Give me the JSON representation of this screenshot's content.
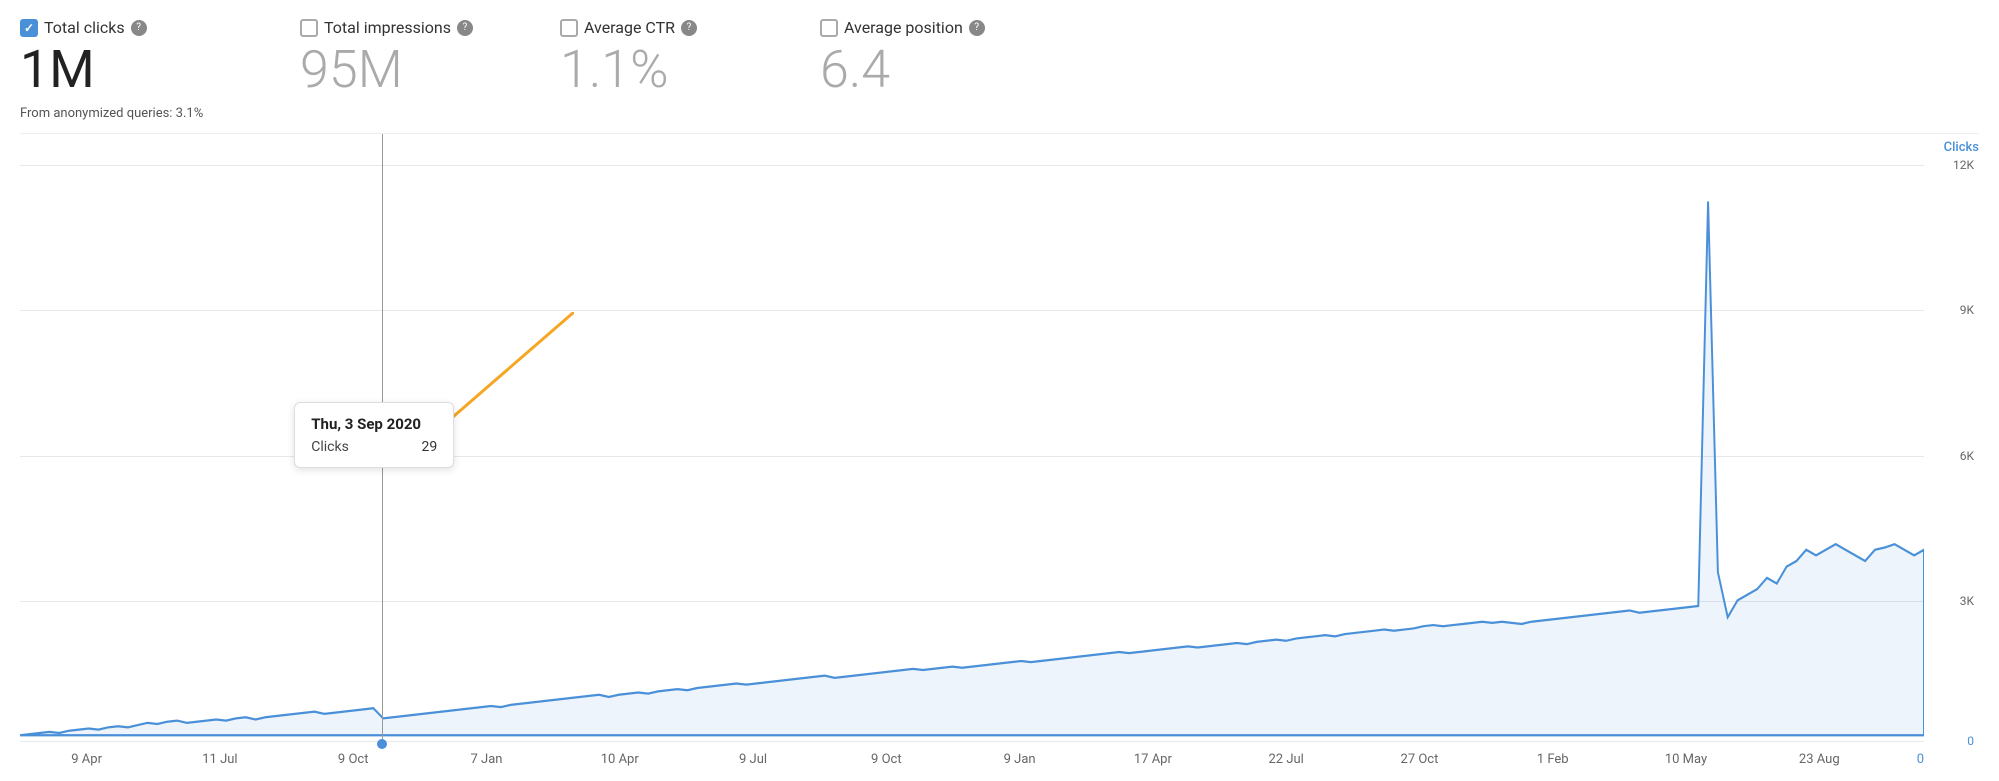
{
  "metrics": [
    {
      "id": "total-clicks",
      "label": "Total clicks",
      "value": "1M",
      "checked": true,
      "help": "?"
    },
    {
      "id": "total-impressions",
      "label": "Total impressions",
      "value": "95M",
      "checked": false,
      "help": "?"
    },
    {
      "id": "average-ctr",
      "label": "Average CTR",
      "value": "1.1%",
      "checked": false,
      "help": "?"
    },
    {
      "id": "average-position",
      "label": "Average position",
      "value": "6.4",
      "checked": false,
      "help": "?"
    }
  ],
  "anonymized_note": "From anonymized queries: 3.1%",
  "chart": {
    "y_axis_label": "Clicks",
    "y_labels": [
      "12K",
      "9K",
      "6K",
      "3K",
      "0"
    ],
    "x_labels": [
      "9 Apr",
      "11 Jul",
      "9 Oct",
      "7 Jan",
      "10 Apr",
      "9 Jul",
      "9 Oct",
      "9 Jan",
      "17 Apr",
      "22 Jul",
      "27 Oct",
      "1 Feb",
      "10 May",
      "23 Aug"
    ],
    "tooltip": {
      "title": "Thu, 3 Sep 2020",
      "metric": "Clicks",
      "value": "29"
    }
  },
  "colors": {
    "primary_blue": "#4a90d9",
    "checked_blue": "#1a73e8",
    "orange_arrow": "#f5a623",
    "chart_line": "#4a90d9"
  }
}
